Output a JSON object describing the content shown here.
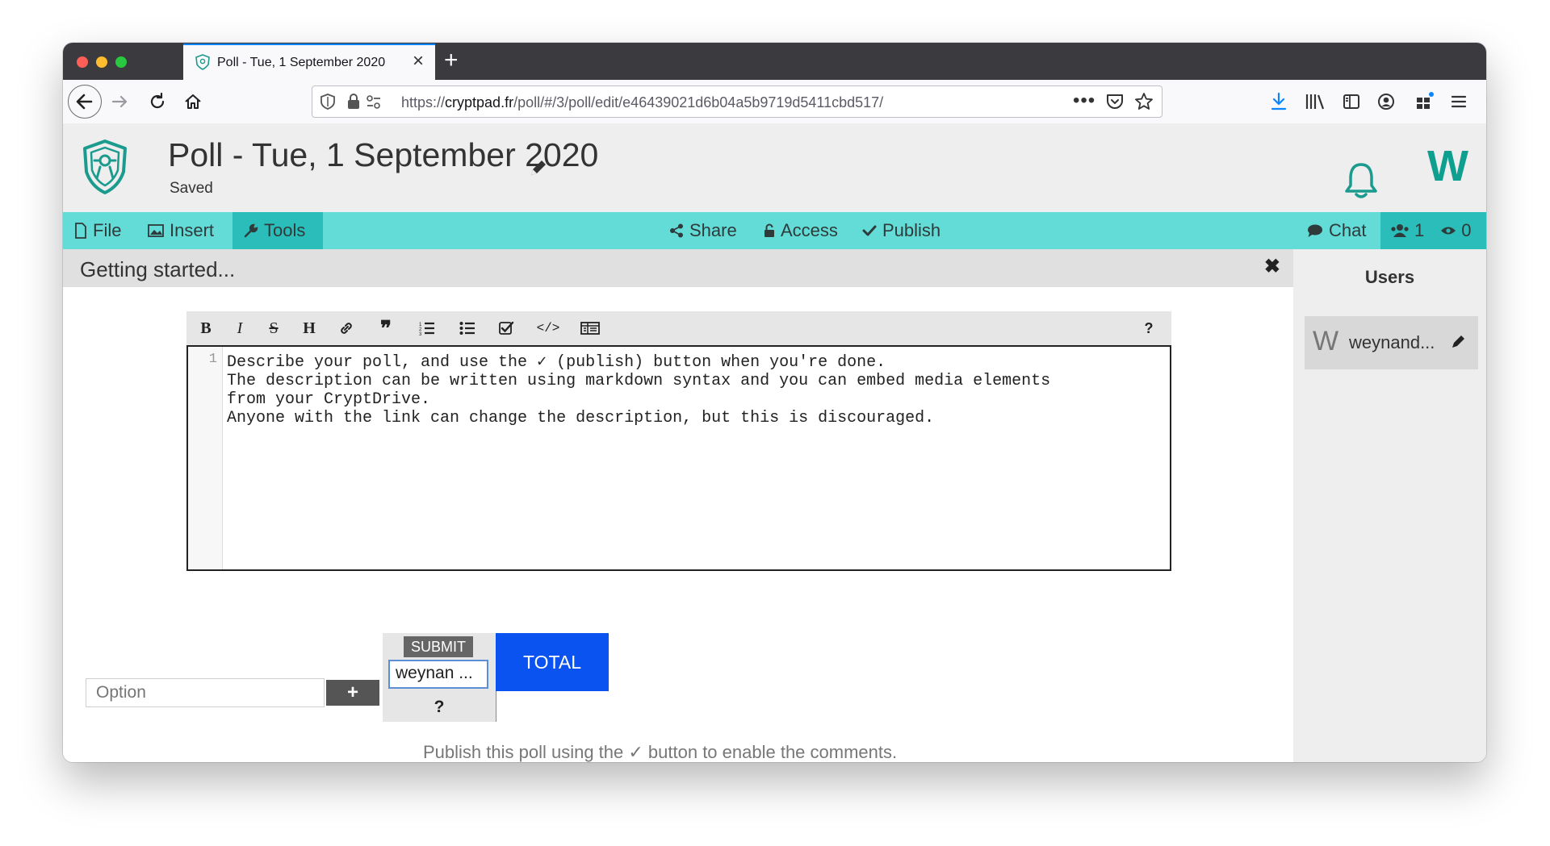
{
  "browser": {
    "tab_title": "Poll - Tue, 1 September 2020",
    "url_prefix": "https://",
    "url_host": "cryptpad.fr",
    "url_path": "/poll/#/3/poll/edit/e46439021d6b04a5b9719d5411cbd517/",
    "traffic_colors": [
      "#ff5f57",
      "#febc2e",
      "#28c840"
    ]
  },
  "header": {
    "title": "Poll - Tue, 1 September 2020",
    "status": "Saved",
    "user_initial": "W"
  },
  "toolbar": {
    "file": "File",
    "insert": "Insert",
    "tools": "Tools",
    "share": "Share",
    "access": "Access",
    "publish": "Publish",
    "chat": "Chat",
    "users_count": "1",
    "viewers_count": "0"
  },
  "banner": {
    "text": "Getting started..."
  },
  "markdown_toolbar": {
    "buttons": [
      "bold-icon",
      "italic-icon",
      "strikethrough-icon",
      "heading-icon",
      "link-icon",
      "quote-icon",
      "ordered-list-icon",
      "bullet-list-icon",
      "checklist-icon",
      "code-icon",
      "table-icon"
    ],
    "help": "?"
  },
  "editor": {
    "line_number": "1",
    "content": "Describe your poll, and use the ✓ (publish) button when you're done.\nThe description can be written using markdown syntax and you can embed media elements\nfrom your CryptDrive.\nAnyone with the link can change the description, but this is discouraged."
  },
  "poll": {
    "option_placeholder": "Option",
    "add_option": "+",
    "submit": "SUBMIT",
    "user_name_value": "weynan ...",
    "unknown": "?",
    "total": "TOTAL",
    "publish_note": "Publish this poll using the ✓ button to enable the comments."
  },
  "sidebar": {
    "title": "Users",
    "users": [
      {
        "initial": "W",
        "name": "weynand..."
      }
    ]
  },
  "colors": {
    "toolbar": "#63dcd7",
    "toolbar_active": "#2bbdb9",
    "brand": "#0f9f8f",
    "total": "#0a53f0"
  }
}
